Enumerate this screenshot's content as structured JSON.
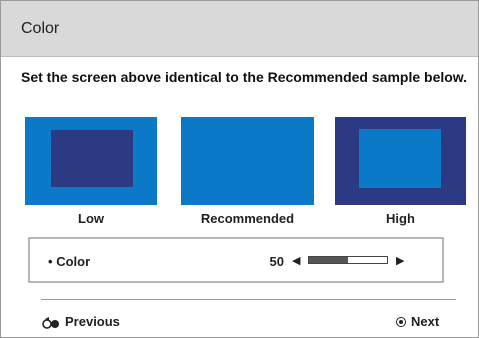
{
  "header": {
    "title": "Color"
  },
  "instruction": "Set the screen above identical to the Recommended sample below.",
  "samples": [
    {
      "label": "Low"
    },
    {
      "label": "Recommended"
    },
    {
      "label": "High"
    }
  ],
  "control": {
    "bullet": "•",
    "name": "Color",
    "value": "50",
    "left_arrow": "◀",
    "right_arrow": "▶",
    "level_fraction": 0.5
  },
  "footer": {
    "previous_label": "Previous",
    "next_label": "Next"
  },
  "colors": {
    "header_bg": "#d9d9d9",
    "sample_blue": "#0a79c7",
    "sample_dark_blue": "#2b3a82"
  }
}
